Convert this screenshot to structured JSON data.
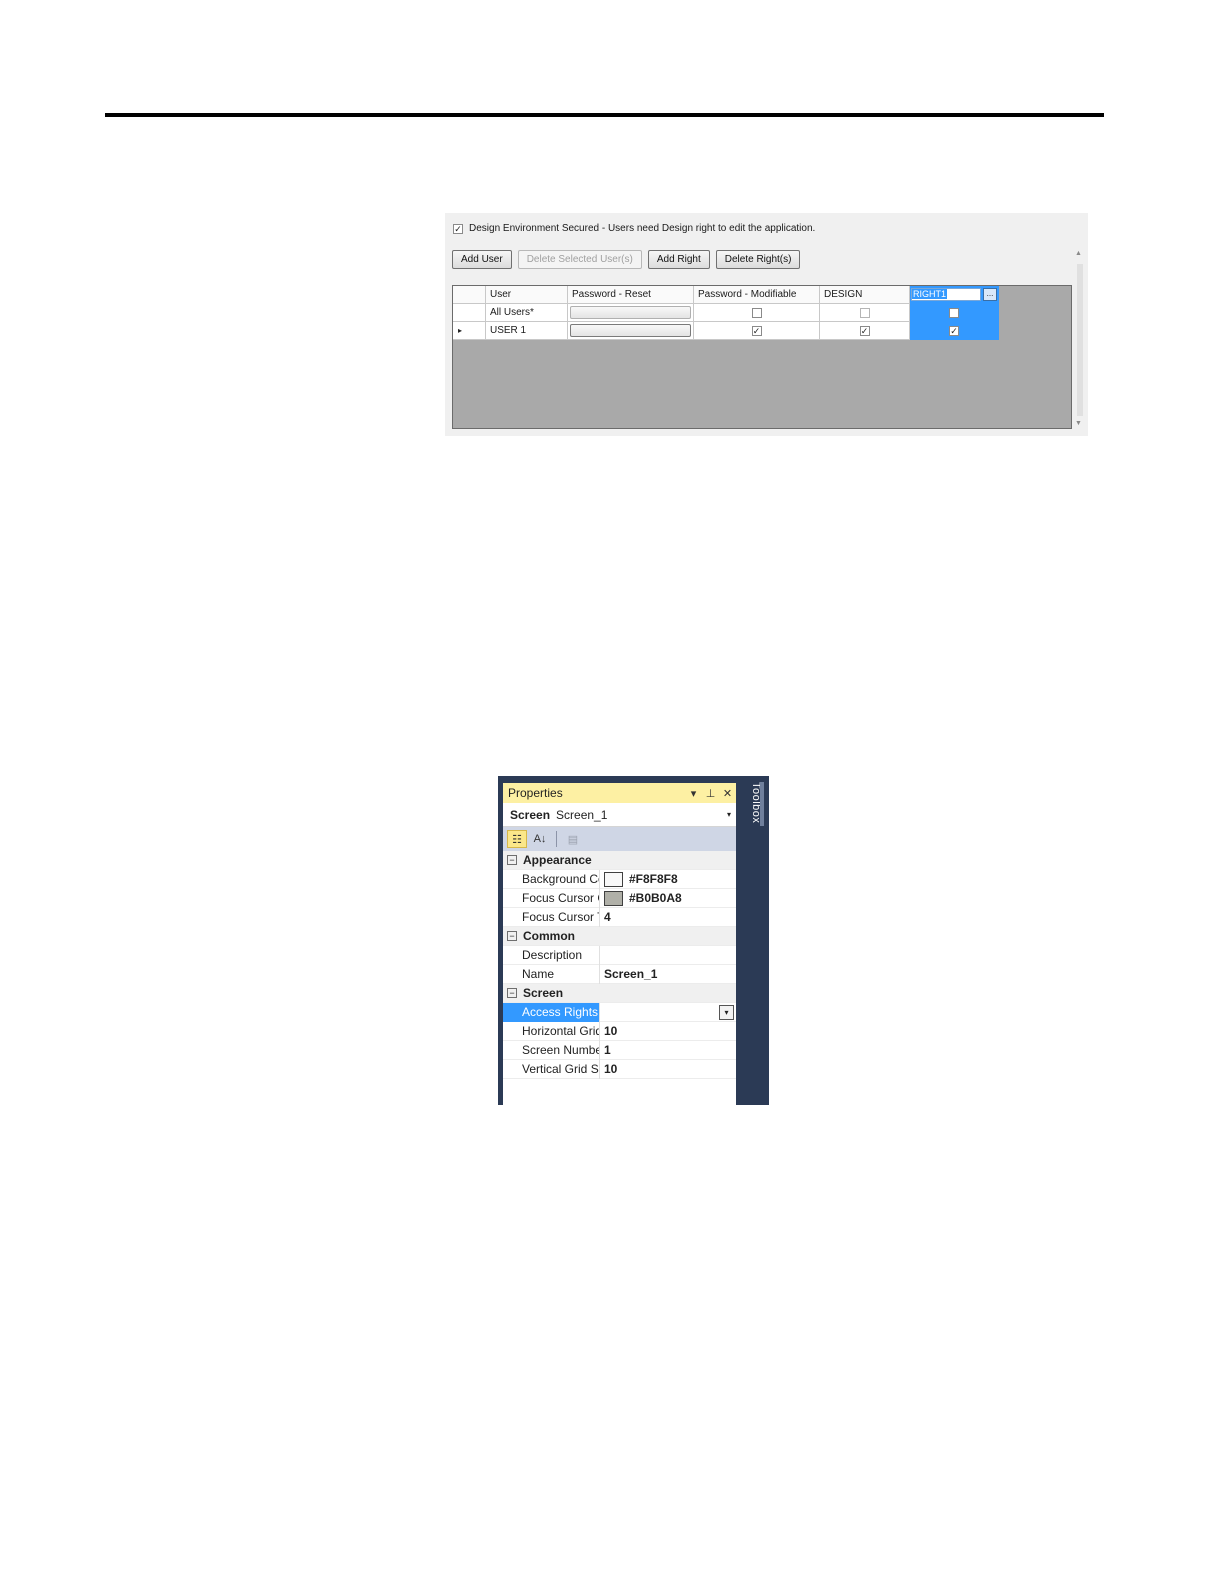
{
  "security": {
    "secured_label": "Design Environment Secured - Users need Design right to edit the application.",
    "secured_checked": true,
    "buttons": {
      "add_user": "Add User",
      "delete_users": "Delete Selected User(s)",
      "add_right": "Add Right",
      "delete_rights": "Delete Right(s)"
    },
    "columns": [
      "User",
      "Password - Reset",
      "Password - Modifiable",
      "DESIGN",
      "RIGHT1"
    ],
    "ellipsis": "...",
    "rows": [
      {
        "user": "All Users*",
        "pw_modifiable": false,
        "design": false,
        "right1": false
      },
      {
        "user": "USER 1",
        "pw_modifiable": true,
        "design": true,
        "right1": true
      }
    ],
    "row_pointer_icon": "▸"
  },
  "properties": {
    "title": "Properties",
    "object_kind": "Screen",
    "object_name": "Screen_1",
    "toolbox_label": "Toolbox",
    "icons": {
      "dropdown": "▾",
      "pin": "📌",
      "close": "✕",
      "categorized": "☷",
      "alphabetical": "A↓",
      "pages": "▤",
      "expander_open": "−"
    },
    "categories": [
      {
        "name": "Appearance",
        "props": [
          {
            "name": "Background Colo",
            "value": "#F8F8F8",
            "swatch": "#F8F8F8"
          },
          {
            "name": "Focus Cursor Colc",
            "value": "#B0B0A8",
            "swatch": "#B0B0A8"
          },
          {
            "name": "Focus Cursor Thic",
            "value": "4"
          }
        ]
      },
      {
        "name": "Common",
        "props": [
          {
            "name": "Description",
            "value": ""
          },
          {
            "name": "Name",
            "value": "Screen_1"
          }
        ]
      },
      {
        "name": "Screen",
        "props": [
          {
            "name": "Access Rights",
            "value": "",
            "selected": true,
            "dropdown": true
          },
          {
            "name": "Horizontal Grid Sp",
            "value": "10"
          },
          {
            "name": "Screen Number",
            "value": "1"
          },
          {
            "name": "Vertical Grid Spac",
            "value": "10"
          }
        ]
      }
    ]
  }
}
